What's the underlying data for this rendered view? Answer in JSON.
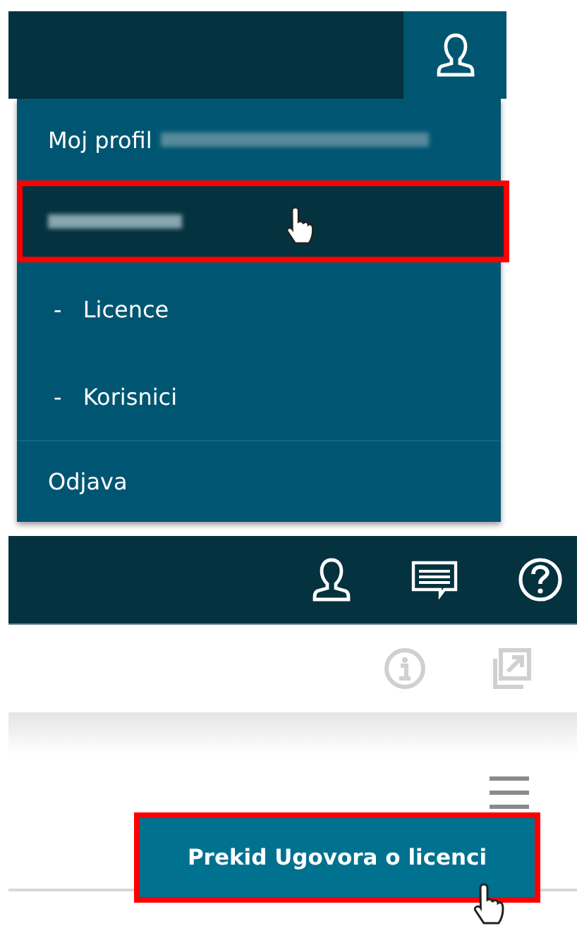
{
  "profile_menu": {
    "items": [
      {
        "kind": "profile",
        "label": "Moj profil",
        "blurred_suffix": true,
        "selected": false
      },
      {
        "kind": "blurred",
        "selected": true
      },
      {
        "kind": "sub",
        "label": "- Licence",
        "selected": false
      },
      {
        "kind": "sub",
        "label": "- Korisnici",
        "selected": false
      },
      {
        "kind": "logout",
        "label": "Odjava",
        "selected": false
      }
    ]
  },
  "license_panel": {
    "action_button": {
      "label": "Prekid Ugovora o licenci",
      "highlighted": true
    }
  }
}
